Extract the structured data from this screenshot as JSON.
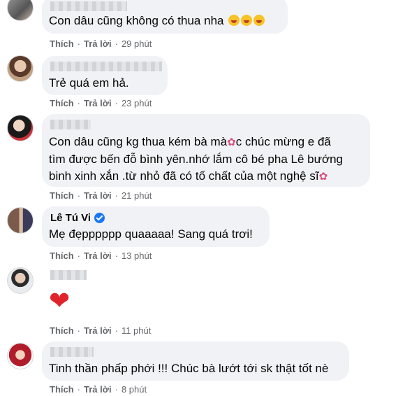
{
  "comments": [
    {
      "text": "Con dâu cũng không có thua nha",
      "emoji": [
        "laughing-face",
        "laughing-face",
        "laughing-face"
      ],
      "like_label": "Thích",
      "reply_label": "Trả lời",
      "time": "29 phút"
    },
    {
      "text": "Trẻ quá em hả.",
      "like_label": "Thích",
      "reply_label": "Trả lời",
      "time": "23 phút"
    },
    {
      "text_line1": "Con dâu cũng kg thua kém bà mà",
      "text_line1_end": "c chúc mừng e đã",
      "text_line2": "tìm được bến đỗ bình yên.nhớ lắm cô bé pha Lê bướng",
      "text_line3": "binh xinh xắn .từ nhỏ đã có tố chất của một nghệ sĩ",
      "emoji": "bouquet",
      "like_label": "Thích",
      "reply_label": "Trả lời",
      "time": "21 phút"
    },
    {
      "name": "Lê Tú Vi",
      "verified": true,
      "text": "Mẹ đẹpppppp quaaaaa! Sang quá trơi!",
      "like_label": "Thích",
      "reply_label": "Trả lời",
      "time": "13 phút"
    },
    {
      "emoji": "red-heart",
      "like_label": "Thích",
      "reply_label": "Trả lời",
      "time": "11 phút"
    },
    {
      "text": "Tinh thần phấp phới !!! Chúc bà lướt tới sk thật tốt nè",
      "like_label": "Thích",
      "reply_label": "Trả lời",
      "time": "8 phút"
    }
  ],
  "colors": {
    "bubble": "#f0f2f5",
    "meta_text": "#65676b",
    "verified": "#1877f2",
    "heart": "#e0242b"
  }
}
